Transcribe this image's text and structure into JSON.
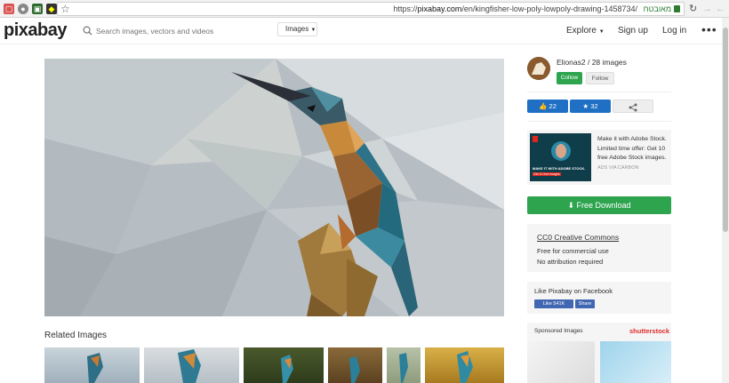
{
  "browser": {
    "url_prefix": "https://",
    "url_host": "pixabay.com",
    "url_path": "/en/kingfisher-low-poly-lowpoly-drawing-1458734/",
    "secure_label": "מאובטח"
  },
  "header": {
    "logo": "pixabay",
    "search_placeholder": "Search images, vectors and videos",
    "search_type": "Images",
    "explore": "Explore",
    "signup": "Sign up",
    "login": "Log in",
    "more": "•••"
  },
  "related": {
    "title": "Related Images"
  },
  "author": {
    "name": "Elionas2 / 28 images",
    "collow": "Collow",
    "follow": "Follow"
  },
  "actions": {
    "likes": "22",
    "favorites": "32"
  },
  "ad": {
    "text": "Make it with Adobe Stock. Limited time offer: Get 10 free Adobe Stock images.",
    "via": "ADS VIA CARBON",
    "img_caption": "MAKE IT WITH ADOBE STOCK.",
    "img_sub": "Get 10 free images"
  },
  "download": {
    "label": "Free Download"
  },
  "license": {
    "title": "CC0 Creative Commons",
    "line1": "Free for commercial use",
    "line2": "No attribution required"
  },
  "facebook": {
    "title": "Like Pixabay on Facebook",
    "like": "Like 541K",
    "share": "Share"
  },
  "sponsored": {
    "title": "Sponsored Images",
    "brand": "shutterstock"
  }
}
